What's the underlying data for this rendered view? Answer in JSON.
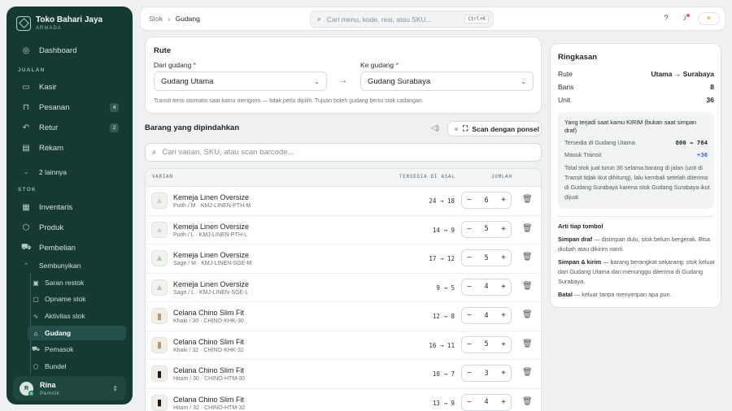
{
  "sidebar": {
    "brand": "Toko Bahari Jaya",
    "brand_sub": "ARMADA",
    "dashboard": "Dashboard",
    "section_jualan": "JUALAN",
    "kasir": "Kasir",
    "pesanan": "Pesanan",
    "pesanan_badge": "4",
    "retur": "Retur",
    "retur_badge": "2",
    "rekam": "Rekam",
    "more": "2 lainnya",
    "section_stok": "STOK",
    "inventaris": "Inventaris",
    "produk": "Produk",
    "pembelian": "Pembelian",
    "sembunyikan": "Sembunyikan",
    "saran_restok": "Saran restok",
    "opname_stok": "Opname stok",
    "aktivitas_stok": "Aktivitas stok",
    "gudang": "Gudang",
    "pemasok": "Pemasok",
    "bundel": "Bundel",
    "user_name": "Rina",
    "user_role": "Pemilik",
    "user_initial": "R"
  },
  "topbar": {
    "crumb_parent": "Stok",
    "crumb_current": "Gudang",
    "search_placeholder": "Cari menu, kode, resi, atau SKU...",
    "shortcut": "Ctrl+K"
  },
  "route": {
    "title": "Rute",
    "from_label": "Dari gudang",
    "from_value": "Gudang Utama",
    "to_label": "Ke gudang",
    "to_value": "Gudang Surabaya",
    "required_mark": "*",
    "hint": "Transit terisi otomatis saat kamu mengirim — tidak perlu dipilih. Tujuan boleh gudang berisi stok cadangan."
  },
  "items": {
    "title": "Barang yang dipindahkan",
    "scan_label": "Scan dengan ponsel",
    "search_placeholder": "Cari varian, SKU, atau scan barcode...",
    "col_variant": "VARIAN",
    "col_stock": "TERSEDIA DI ASAL",
    "col_qty": "JUMLAH",
    "rows": [
      {
        "name": "Kemeja Linen Oversize",
        "variant": "Putih / M · KMJ-LINEN-PTH-M",
        "stock": "24 → 18",
        "qty": "6"
      },
      {
        "name": "Kemeja Linen Oversize",
        "variant": "Putih / L · KMJ-LINEN-PTH-L",
        "stock": "14 → 9",
        "qty": "5"
      },
      {
        "name": "Kemeja Linen Oversize",
        "variant": "Sage / M · KMJ-LINEN-SGE-M",
        "stock": "17 → 12",
        "qty": "5"
      },
      {
        "name": "Kemeja Linen Oversize",
        "variant": "Sage / L · KMJ-LINEN-SGE-L",
        "stock": "9 → 5",
        "qty": "4"
      },
      {
        "name": "Celana Chino Slim Fit",
        "variant": "Khaki / 30 · CHINO-KHK-30",
        "stock": "12 → 8",
        "qty": "4"
      },
      {
        "name": "Celana Chino Slim Fit",
        "variant": "Khaki / 32 · CHINO-KHK-32",
        "stock": "16 → 11",
        "qty": "5"
      },
      {
        "name": "Celana Chino Slim Fit",
        "variant": "Hitam / 30 · CHINO-HTM-30",
        "stock": "10 → 7",
        "qty": "3"
      },
      {
        "name": "Celana Chino Slim Fit",
        "variant": "Hitam / 32 · CHINO-HTM-32",
        "stock": "13 → 9",
        "qty": "4"
      }
    ]
  },
  "summary": {
    "title": "Ringkasan",
    "route_label": "Rute",
    "route_from": "Utama",
    "route_to": "Surabaya",
    "rows_label": "Baris",
    "rows_value": "8",
    "units_label": "Unit",
    "units_value": "36",
    "info_title": "Yang terjadi saat kamu KIRIM (bukan saat simpan draf)",
    "available_label": "Tersedia di Gudang Utama",
    "available_value": "800 → 764",
    "transit_label": "Masuk Transit",
    "transit_value": "+36",
    "info_text": "Total stok jual turun 36 selama barang di jalan (unit di Transit tidak ikut dihitung), lalu kembali setelah diterima di Gudang Surabaya karena stok Gudang Surabaya ikut dijual.",
    "legend_title": "Arti tiap tombol",
    "draft_term": "Simpan draf",
    "draft_desc": " — disimpan dulu, stok belum bergerak. Bisa diubah atau dikirim nanti.",
    "send_term": "Simpan & kirim",
    "send_desc": " — barang berangkat sekarang: stok keluar dari Gudang Utama dan menunggu diterima di Gudang Surabaya.",
    "cancel_term": "Batal",
    "cancel_desc": " — keluar tanpa menyimpan apa pun."
  },
  "colors": {
    "sidebar_bg": "#163a33",
    "accent_blue": "#2f6bd9",
    "required": "#c2352b"
  }
}
